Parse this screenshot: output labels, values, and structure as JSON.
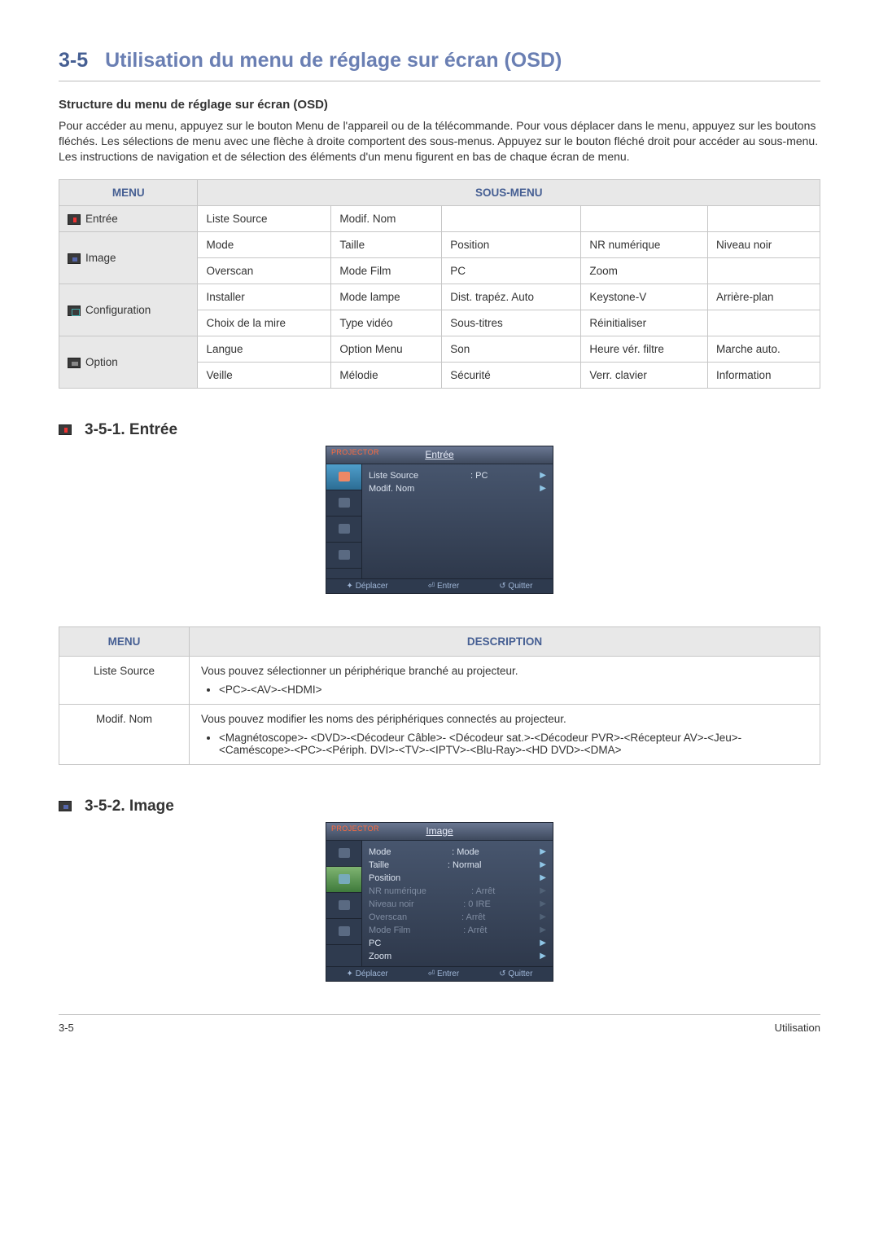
{
  "page": {
    "section_num": "3-5",
    "section_title": "Utilisation du menu de réglage sur écran (OSD)",
    "footer_left": "3-5",
    "footer_right": "Utilisation"
  },
  "intro": {
    "subhead": "Structure du menu de réglage sur écran (OSD)",
    "para": "Pour accéder au menu, appuyez sur le bouton Menu de l'appareil ou de la télécommande. Pour vous déplacer dans le menu, appuyez sur les boutons fléchés. Les sélections de menu avec une flèche à droite comportent des sous-menus. Appuyez sur le bouton fléché droit pour accéder au sous-menu. Les instructions de navigation et de sélection des éléments d'un menu figurent en bas de chaque écran de menu."
  },
  "struct_table": {
    "head_menu": "MENU",
    "head_sub": "SOUS-MENU",
    "rows": [
      {
        "icon": "red",
        "menu": "Entrée",
        "cells": [
          "Liste Source",
          "Modif. Nom",
          "",
          "",
          ""
        ]
      },
      {
        "icon": "blue",
        "menu": "Image",
        "cells": [
          "Mode",
          "Taille",
          "Position",
          "NR numérique",
          "Niveau noir"
        ]
      },
      {
        "icon": "",
        "menu": "",
        "cells": [
          "Overscan",
          "Mode Film",
          "PC",
          "Zoom",
          ""
        ]
      },
      {
        "icon": "teal",
        "menu": "Configuration",
        "cells": [
          "Installer",
          "Mode lampe",
          "Dist. trapéz. Auto",
          "Keystone-V",
          "Arrière-plan"
        ]
      },
      {
        "icon": "",
        "menu": "",
        "cells": [
          "Choix de la mire",
          "Type vidéo",
          "Sous-titres",
          "Réinitialiser",
          ""
        ]
      },
      {
        "icon": "gray",
        "menu": "Option",
        "cells": [
          "Langue",
          "Option Menu",
          "Son",
          "Heure vér. filtre",
          "Marche auto."
        ]
      },
      {
        "icon": "",
        "menu": "",
        "cells": [
          "Veille",
          "Mélodie",
          "Sécurité",
          "Verr. clavier",
          "Information"
        ]
      }
    ]
  },
  "s351": {
    "title": "3-5-1. Entrée",
    "osd": {
      "projector_label": "PROJECTOR",
      "title": "Entrée",
      "rows": [
        {
          "label": "Liste Source",
          "value": ": PC",
          "disabled": false
        },
        {
          "label": "Modif. Nom",
          "value": "",
          "disabled": false
        }
      ],
      "footer": {
        "move": "Déplacer",
        "enter": "Entrer",
        "quit": "Quitter"
      },
      "active_tab": 0
    },
    "desc_table": {
      "head_menu": "MENU",
      "head_desc": "DESCRIPTION",
      "rows": [
        {
          "menu": "Liste Source",
          "text": "Vous pouvez sélectionner un périphérique branché au projecteur.",
          "bullet": "<PC>-<AV>-<HDMI>"
        },
        {
          "menu": "Modif. Nom",
          "text": "Vous pouvez modifier les noms des périphériques connectés au projecteur.",
          "bullet": "<Magnétoscope>- <DVD>-<Décodeur Câble>- <Décodeur sat.>-<Décodeur PVR>-<Récepteur AV>-<Jeu>-<Caméscope>-<PC>-<Périph. DVI>-<TV>-<IPTV>-<Blu-Ray>-<HD DVD>-<DMA>"
        }
      ]
    }
  },
  "s352": {
    "title": "3-5-2. Image",
    "osd": {
      "projector_label": "PROJECTOR",
      "title": "Image",
      "rows": [
        {
          "label": "Mode",
          "value": ": Mode",
          "disabled": false
        },
        {
          "label": "Taille",
          "value": ": Normal",
          "disabled": false
        },
        {
          "label": "Position",
          "value": "",
          "disabled": false
        },
        {
          "label": "NR numérique",
          "value": ": Arrêt",
          "disabled": true
        },
        {
          "label": "Niveau noir",
          "value": ": 0 IRE",
          "disabled": true
        },
        {
          "label": "Overscan",
          "value": ": Arrêt",
          "disabled": true
        },
        {
          "label": "Mode Film",
          "value": ": Arrêt",
          "disabled": true
        },
        {
          "label": "PC",
          "value": "",
          "disabled": false
        },
        {
          "label": "Zoom",
          "value": "",
          "disabled": false
        }
      ],
      "footer": {
        "move": "Déplacer",
        "enter": "Entrer",
        "quit": "Quitter"
      },
      "active_tab": 1
    }
  }
}
